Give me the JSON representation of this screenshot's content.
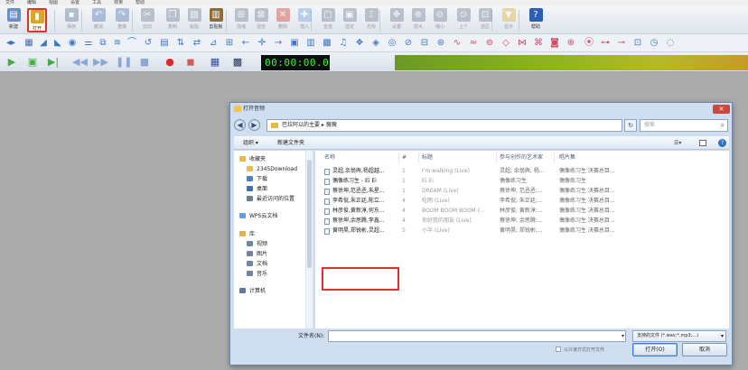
{
  "menu": [
    "文件",
    "编辑",
    "视图",
    "设置",
    "工具",
    "效果",
    "帮助"
  ],
  "toolbar": {
    "buttons": [
      {
        "label": "新建",
        "icon": "new-file-icon",
        "color": "#6c8fc7",
        "dim": false
      },
      {
        "label": "打开",
        "icon": "open-folder-icon",
        "color": "#d9a62a",
        "dim": false,
        "active": true
      },
      {
        "label": "保存",
        "icon": "save-icon",
        "color": "#6f7f98",
        "dim": true
      },
      {
        "label": "撤消",
        "icon": "undo-icon",
        "color": "#5f7fb8",
        "dim": true
      },
      {
        "label": "重做",
        "icon": "redo-icon",
        "color": "#5f7fb8",
        "dim": true
      },
      {
        "label": "剪切",
        "icon": "cut-icon",
        "color": "#7b8899",
        "dim": true
      },
      {
        "label": "复制",
        "icon": "copy-icon",
        "color": "#7b8899",
        "dim": true
      },
      {
        "label": "粘贴",
        "icon": "paste-icon",
        "color": "#7b8899",
        "dim": true
      },
      {
        "label": "剪贴板",
        "icon": "clipboard-icon",
        "color": "#8a6d3b",
        "dim": false
      },
      {
        "label": "混缩",
        "icon": "mix-icon",
        "color": "#7b8899",
        "dim": true
      },
      {
        "label": "混音",
        "icon": "mix-paste-icon",
        "color": "#7b8899",
        "dim": true
      },
      {
        "label": "删除",
        "icon": "delete-icon",
        "color": "#d64a3a",
        "dim": true
      },
      {
        "label": "插入",
        "icon": "insert-icon",
        "color": "#7fa3d9",
        "dim": true
      },
      {
        "label": "全选",
        "icon": "select-all-icon",
        "color": "#7b8899",
        "dim": true
      },
      {
        "label": "选定",
        "icon": "select-icon",
        "color": "#7b8899",
        "dim": true
      },
      {
        "label": "光标",
        "icon": "cursor-icon",
        "color": "#7b8899",
        "dim": true
      },
      {
        "label": "设置",
        "icon": "settings-tool-icon",
        "color": "#7b8899",
        "dim": true
      },
      {
        "label": "放大",
        "icon": "zoom-in-icon",
        "color": "#7b8899",
        "dim": true
      },
      {
        "label": "缩小",
        "icon": "zoom-out-icon",
        "color": "#7b8899",
        "dim": true
      },
      {
        "label": "上个",
        "icon": "zoom-prev-icon",
        "color": "#7b8899",
        "dim": true
      },
      {
        "label": "选区",
        "icon": "zoom-selection-icon",
        "color": "#7b8899",
        "dim": true
      },
      {
        "label": "显示",
        "icon": "show-icon",
        "color": "#d9b84a",
        "dim": true
      },
      {
        "label": "帮助",
        "icon": "help-icon",
        "color": "#2c5fb3",
        "dim": false
      }
    ]
  },
  "transport": {
    "time": "00:00:00.0"
  },
  "dialog": {
    "title": "打开音频",
    "address": "巴拉阿以的主要 ▸ 薇薇",
    "search_placeholder": "搜索",
    "organize_label": "组织 ▾",
    "new_folder_label": "新建文件夹",
    "nav": [
      {
        "label": "收藏夹",
        "icon": "favorites-star-icon",
        "color": "#e8b93c",
        "indent": 0
      },
      {
        "label": "2345Download",
        "icon": "folder-icon",
        "color": "#e6bd55",
        "indent": 1
      },
      {
        "label": "下载",
        "icon": "download-folder-icon",
        "color": "#4b7fc7",
        "indent": 1
      },
      {
        "label": "桌面",
        "icon": "desktop-icon",
        "color": "#3d6fb8",
        "indent": 1
      },
      {
        "label": "最近访问的位置",
        "icon": "recent-places-icon",
        "color": "#6e7f98",
        "indent": 1
      },
      {
        "label": "WPS云文档",
        "icon": "wps-cloud-icon",
        "color": "#5da0e6",
        "indent": 0
      },
      {
        "label": "库",
        "icon": "libraries-icon",
        "color": "#e4b24c",
        "indent": 0
      },
      {
        "label": "视频",
        "icon": "videos-icon",
        "color": "#6f86a8",
        "indent": 1
      },
      {
        "label": "图片",
        "icon": "pictures-icon",
        "color": "#6f86a8",
        "indent": 1
      },
      {
        "label": "文档",
        "icon": "documents-icon",
        "color": "#6f86a8",
        "indent": 1
      },
      {
        "label": "音乐",
        "icon": "music-icon",
        "color": "#6f86a8",
        "indent": 1
      },
      {
        "label": "计算机",
        "icon": "computer-icon",
        "color": "#5b7aa6",
        "indent": 0
      }
    ],
    "columns": [
      "名称",
      "#",
      "标题",
      "参与创作的艺术家",
      "唱片集"
    ],
    "files": [
      {
        "name": "灵超,余翁舆,杨超越...",
        "track": "1",
        "title": "I'm walking (Live)",
        "artist": "灵超; 余翁舆; 杨...",
        "album": "偶像练习生 决赛总目..."
      },
      {
        "name": "偶像练习生 - Ei Ei",
        "track": "1",
        "title": "Ei Ei",
        "artist": "偶像练习生",
        "album": "偶像练习生"
      },
      {
        "name": "蔡徐坤,范丞丞,朱星...",
        "track": "1",
        "title": "DREAM (Live)",
        "artist": "蔡徐坤; 范丞丞;...",
        "album": "偶像练习生 决赛总目..."
      },
      {
        "name": "李希侃,朱正廷,陈立...",
        "track": "4",
        "title": "吃雨 (Live)",
        "artist": "李希侃; 朱正廷;...",
        "album": "偶像练习生 决赛总目..."
      },
      {
        "name": "林彦俊,黄新淳,何东...",
        "track": "4",
        "title": "BOOM BOOM BOOM (...",
        "artist": "林彦俊; 黄新淳;...",
        "album": "偶像练习生 决赛总目..."
      },
      {
        "name": "蔡徐坤,余思腾,李鑫...",
        "track": "4",
        "title": "你好我的朋友 (Live)",
        "artist": "蔡徐坤; 余思腾;...",
        "album": "偶像练习生 决赛总目..."
      },
      {
        "name": "黄明昊,郑锐彬,灵超...",
        "track": "5",
        "title": "小半 (Live)",
        "artist": "黄明昊; 郑锐彬;...",
        "album": "偶像练习生 决赛总目..."
      }
    ],
    "filename_label": "文件名(N):",
    "filename_value": "",
    "filetype_value": "支持的文件 (*.wav;*.mp3;...)",
    "readonly_label": "以只读方式打开文件",
    "open_button": "打开(O)",
    "cancel_button": "取消"
  }
}
